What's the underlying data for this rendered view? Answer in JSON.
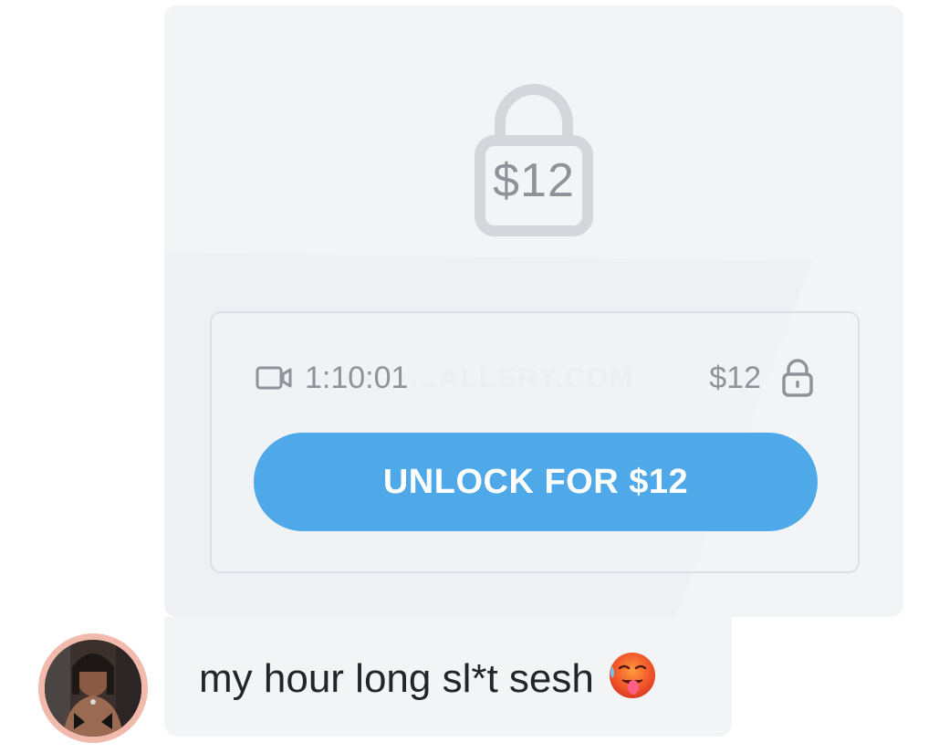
{
  "locked_media": {
    "hero_price": "$12",
    "duration": "1:10:01",
    "watermark": "...ALLERY.COM",
    "price": "$12",
    "unlock_label": "UNLOCK FOR $12",
    "icons": {
      "hero": "padlock-icon",
      "media_type": "video-camera-icon",
      "price_lock": "padlock-icon"
    }
  },
  "message": {
    "text": "my hour long sl*t sesh",
    "emoji": "hot-face-emoji"
  },
  "sender": {
    "avatar": "avatar"
  },
  "colors": {
    "accent": "#4fa9e8",
    "bubble": "#f3f4f6",
    "muted": "#8f9399",
    "avatar_ring": "#f2b9ad"
  }
}
